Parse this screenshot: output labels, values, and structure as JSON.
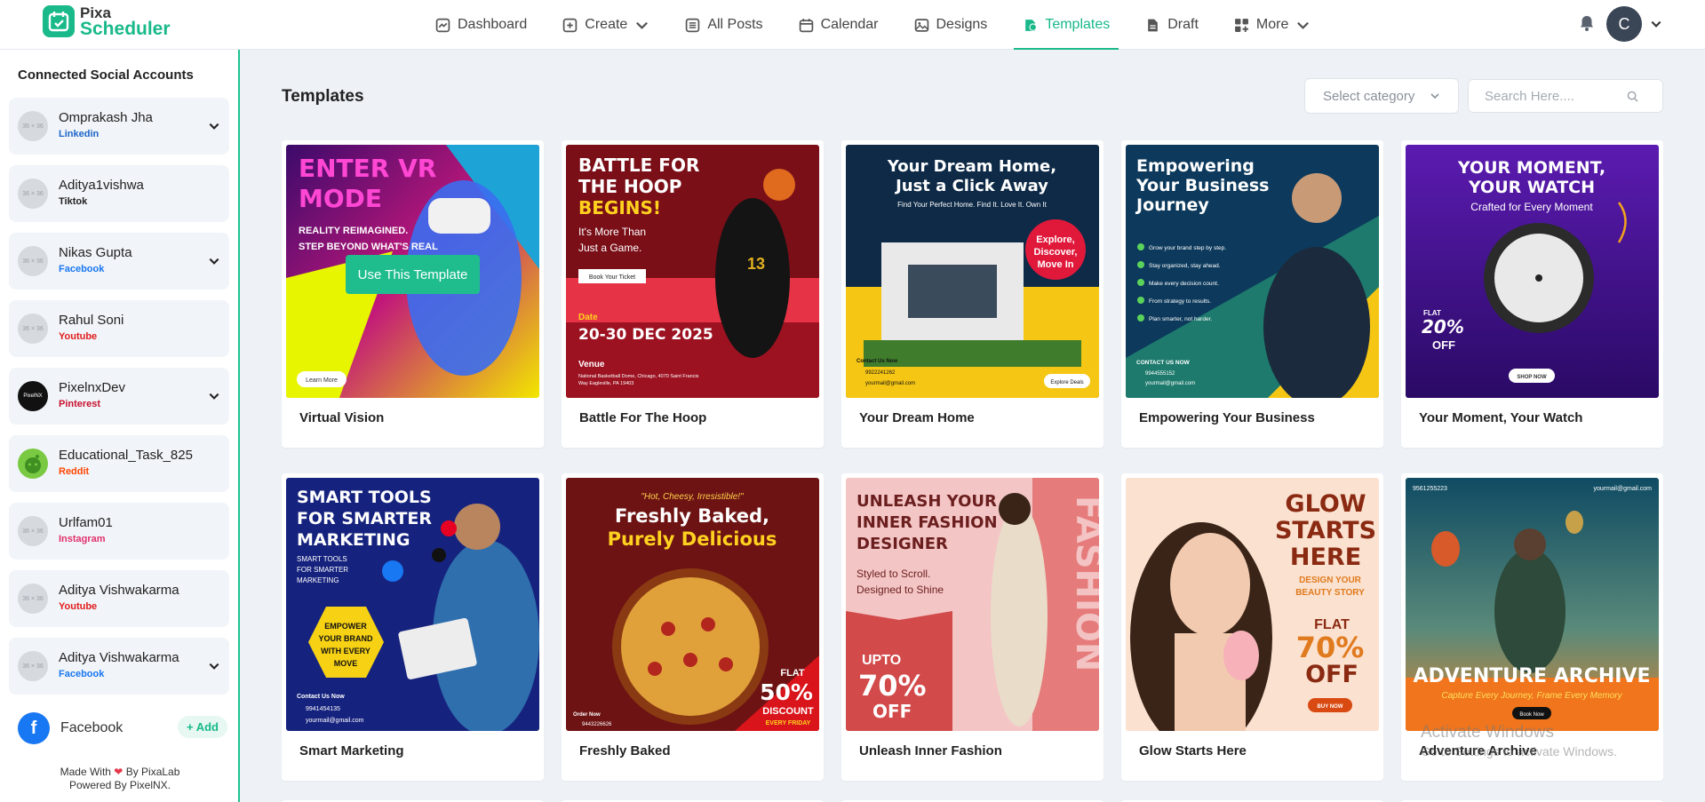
{
  "app": {
    "logo_line1": "Pixa",
    "logo_line2": "Scheduler"
  },
  "nav": [
    {
      "label": "Dashboard",
      "icon": "dashboard-icon"
    },
    {
      "label": "Create",
      "icon": "create-icon",
      "dropdown": true
    },
    {
      "label": "All Posts",
      "icon": "list-icon"
    },
    {
      "label": "Calendar",
      "icon": "calendar-icon"
    },
    {
      "label": "Designs",
      "icon": "image-icon"
    },
    {
      "label": "Templates",
      "icon": "templates-icon",
      "active": true
    },
    {
      "label": "Draft",
      "icon": "file-icon"
    },
    {
      "label": "More",
      "icon": "grid-plus-icon",
      "dropdown": true
    }
  ],
  "user": {
    "initial": "C"
  },
  "sidebar": {
    "title": "Connected Social Accounts",
    "accounts": [
      {
        "name": "Omprakash Jha",
        "network": "Linkedin",
        "color": "#1c66c8",
        "expandable": true,
        "avatar": "36 × 36"
      },
      {
        "name": "Aditya1vishwa",
        "network": "Tiktok",
        "color": "#222222",
        "expandable": false,
        "avatar": "36 × 36"
      },
      {
        "name": "Nikas Gupta",
        "network": "Facebook",
        "color": "#1877f2",
        "expandable": true,
        "avatar": "36 × 36"
      },
      {
        "name": "Rahul Soni",
        "network": "Youtube",
        "color": "#e11d1d",
        "expandable": false,
        "avatar": "36 × 36"
      },
      {
        "name": "PixelnxDev",
        "network": "Pinterest",
        "color": "#c8102e",
        "expandable": true,
        "avatar": "PixelNX"
      },
      {
        "name": "Educational_Task_825",
        "network": "Reddit",
        "color": "#ff4500",
        "expandable": false,
        "avatar": ""
      },
      {
        "name": "Urlfam01",
        "network": "Instagram",
        "color": "#e1306c",
        "expandable": false,
        "avatar": "36 × 36"
      },
      {
        "name": "Aditya Vishwakarma",
        "network": "Youtube",
        "color": "#e11d1d",
        "expandable": false,
        "avatar": "36 × 36"
      },
      {
        "name": "Aditya Vishwakarma",
        "network": "Facebook",
        "color": "#1877f2",
        "expandable": true,
        "avatar": "36 × 36"
      }
    ],
    "facebook_label": "Facebook",
    "add_label": "Add",
    "made_with": "Made With",
    "by": "By PixaLab",
    "powered_by": "Powered By PixelNX."
  },
  "main": {
    "title": "Templates",
    "category_placeholder": "Select category",
    "search_placeholder": "Search Here....",
    "use_button": "Use This Template",
    "templates": [
      {
        "name": "Virtual Vision"
      },
      {
        "name": "Battle For The Hoop"
      },
      {
        "name": "Your Dream Home"
      },
      {
        "name": "Empowering Your Business"
      },
      {
        "name": "Your Moment, Your Watch"
      },
      {
        "name": "Smart Marketing"
      },
      {
        "name": "Freshly Baked"
      },
      {
        "name": "Unleash Inner Fashion"
      },
      {
        "name": "Glow Starts Here"
      },
      {
        "name": "Adventure Archive"
      }
    ]
  },
  "thumbs": {
    "t1": {
      "h1": "ENTER VR",
      "h2": "MODE",
      "s1": "REALITY REIMAGINED.",
      "s2": "STEP BEYOND WHAT'S REAL",
      "btn": "Learn More"
    },
    "t2": {
      "h1": "BATTLE FOR",
      "h2": "THE HOOP",
      "h3": "BEGINS!",
      "s1": "It's More Than",
      "s2": "Just a Game.",
      "btn": "Book Your Ticket",
      "date_label": "Date",
      "date": "20-30 DEC 2025",
      "venue": "Venue",
      "addr1": "National Basketball Dome, Chicago, 4070 Saint Francis",
      "addr2": "Way Eagleville, PA 19403",
      "jersey": "13"
    },
    "t3": {
      "h1": "Your Dream Home,",
      "h2": "Just a Click Away",
      "sub": "Find Your Perfect Home. Find It. Love It. Own It",
      "b1": "Explore,",
      "b2": "Discover,",
      "b3": "Move In",
      "contact": "Contact Us Now",
      "phone": "9922241262",
      "email": "yourmail@gmail.com",
      "btn": "Explore Deals"
    },
    "t4": {
      "h1": "Empowering",
      "h2": "Your Business",
      "h3": "Journey",
      "l1": "Grow your brand step by step.",
      "l2": "Stay organized, stay ahead.",
      "l3": "Make every decision count.",
      "l4": "From strategy to results.",
      "l5": "Plan smarter, not harder.",
      "contact": "CONTACT US NOW",
      "phone": "9944555152",
      "email": "yourmail@gmail.com"
    },
    "t5": {
      "h1": "YOUR MOMENT,",
      "h2": "YOUR WATCH",
      "sub": "Crafted for Every Moment",
      "flat": "FLAT",
      "pct": "20%",
      "off": "OFF",
      "btn": "SHOP NOW"
    },
    "t6": {
      "h1": "SMART TOOLS",
      "h2": "FOR SMARTER",
      "h3": "MARKETING",
      "s1": "SMART TOOLS",
      "s2": "FOR SMARTER",
      "s3": "MARKETING",
      "b1": "EMPOWER",
      "b2": "YOUR BRAND",
      "b3": "WITH EVERY",
      "b4": "MOVE",
      "contact": "Contact Us Now",
      "phone": "9941454135",
      "email": "yourmail@gmail.com"
    },
    "t7": {
      "q": "\"Hot, Cheesy, Irresistible!\"",
      "h1": "Freshly Baked,",
      "h2": "Purely Delicious",
      "flat": "FLAT",
      "pct": "50%",
      "disc": "DISCOUNT",
      "every": "EVERY FRIDAY",
      "order": "Order Now",
      "phone": "9443226626"
    },
    "t8": {
      "h1": "UNLEASH YOUR",
      "h2": "INNER FASHION",
      "h3": "DESIGNER",
      "s1": "Styled to Scroll.",
      "s2": "Designed to Shine",
      "upto": "UPTO",
      "pct": "70%",
      "off": "OFF",
      "vert": "FASHION"
    },
    "t9": {
      "h1": "GLOW",
      "h2": "STARTS",
      "h3": "HERE",
      "s1": "DESIGN YOUR",
      "s2": "BEAUTY STORY",
      "flat": "FLAT",
      "pct": "70%",
      "off": "OFF",
      "btn": "BUY NOW"
    },
    "t10": {
      "phone": "9561255223",
      "email": "yourmail@gmail.com",
      "h1": "ADVENTURE ARCHIVE",
      "sub": "Capture Every Journey, Frame Every Memory",
      "btn": "Book Now"
    }
  },
  "watermark": {
    "line1": "Activate Windows",
    "line2": "Go to Settings to activate Windows."
  }
}
